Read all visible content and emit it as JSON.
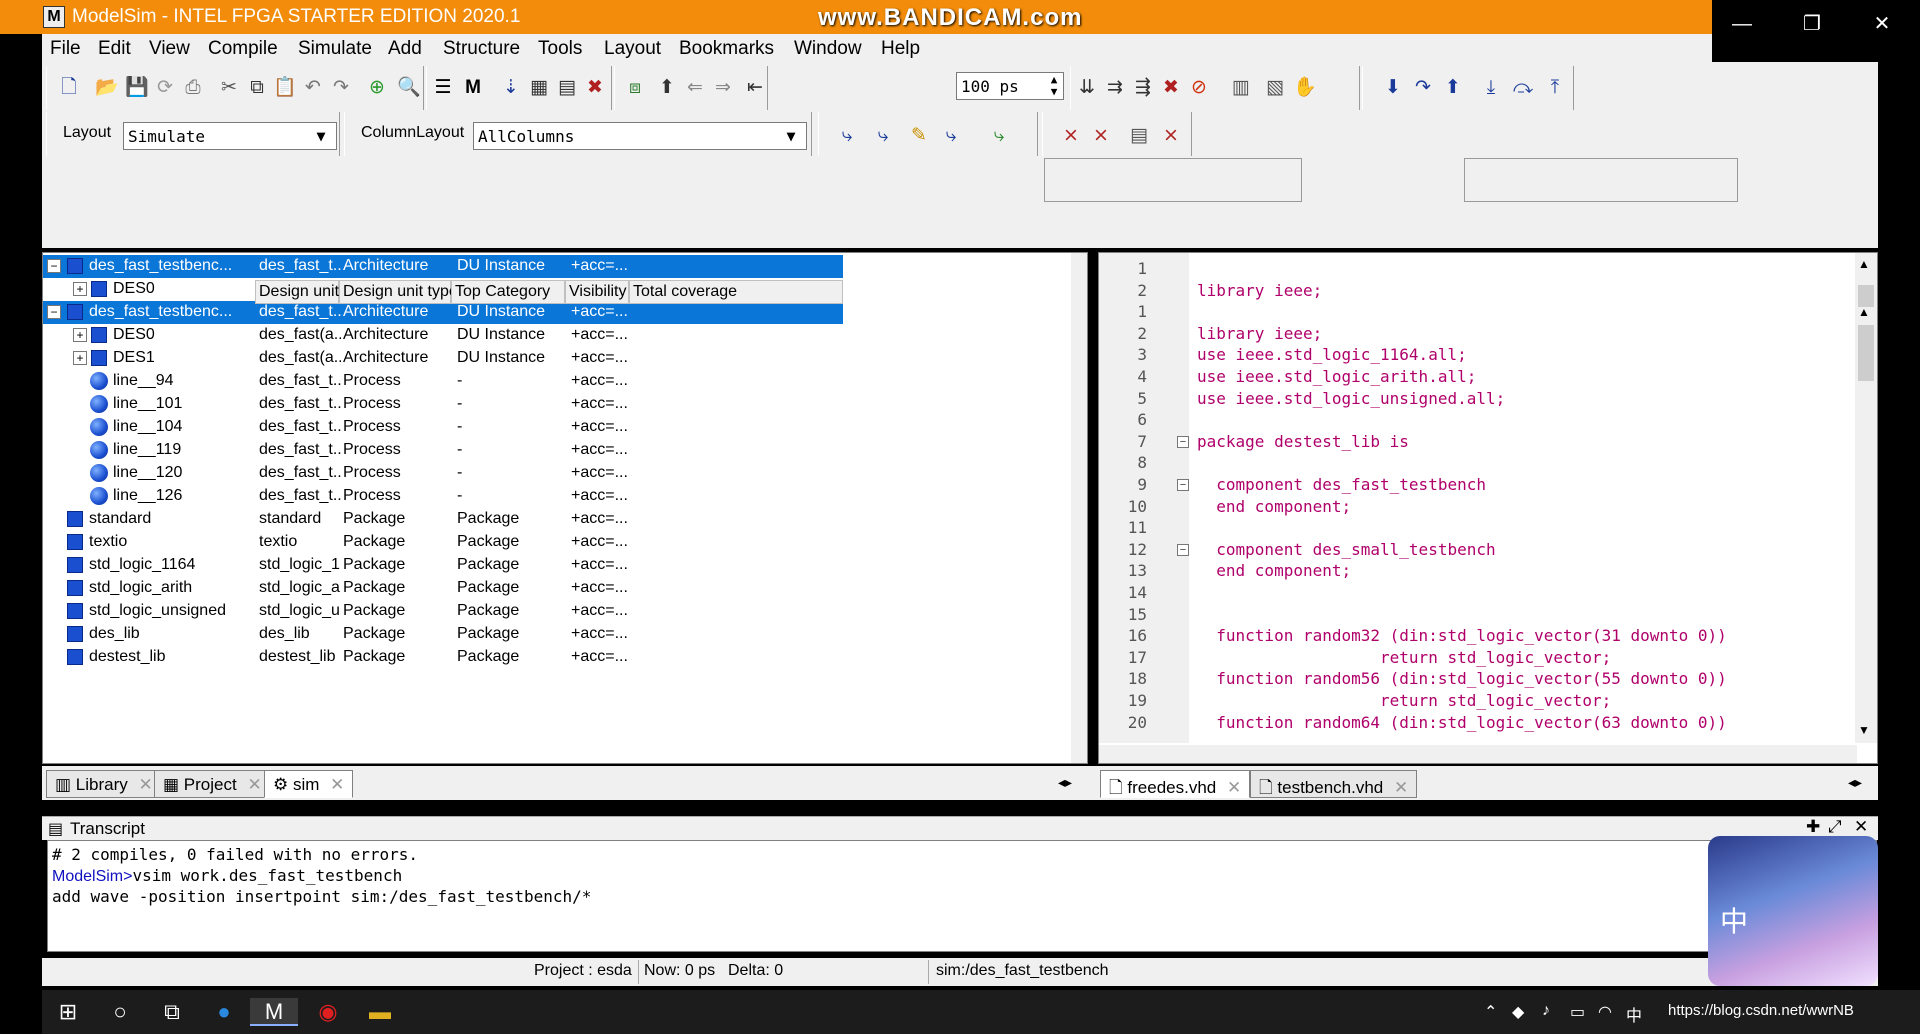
{
  "window": {
    "title": "ModelSim - INTEL FPGA STARTER EDITION 2020.1",
    "watermark": "www.BANDICAM.com",
    "app_icon": "M"
  },
  "menu": [
    "File",
    "Edit",
    "View",
    "Compile",
    "Simulate",
    "Add",
    "Structure",
    "Tools",
    "Layout",
    "Bookmarks",
    "Window",
    "Help"
  ],
  "toolbar": {
    "time_value": "100 ps",
    "layout_label": "Layout",
    "layout_value": "Simulate",
    "column_layout_label": "ColumnLayout",
    "column_layout_value": "AllColumns"
  },
  "sim": {
    "headers": [
      "Design unit",
      "Design unit type",
      "Top Category",
      "Visibility",
      "Total coverage"
    ],
    "rows": [
      {
        "name": "des_fast_testbenc...",
        "du": "des_fast_t...",
        "type": "Architecture",
        "cat": "DU Instance",
        "vis": "+acc=...",
        "selected": true
      },
      {
        "name": "DES0",
        "du": "",
        "type": "",
        "cat": "",
        "vis": "",
        "selected": false
      },
      {
        "name": "des_fast_testbenc...",
        "du": "des_fast_t...",
        "type": "Architecture",
        "cat": "DU Instance",
        "vis": "+acc=...",
        "selected": true
      },
      {
        "name": "DES0",
        "du": "des_fast(a...",
        "type": "Architecture",
        "cat": "DU Instance",
        "vis": "+acc=..."
      },
      {
        "name": "DES1",
        "du": "des_fast(a...",
        "type": "Architecture",
        "cat": "DU Instance",
        "vis": "+acc=..."
      },
      {
        "name": "line__94",
        "du": "des_fast_t...",
        "type": "Process",
        "cat": "-",
        "vis": "+acc=..."
      },
      {
        "name": "line__101",
        "du": "des_fast_t...",
        "type": "Process",
        "cat": "-",
        "vis": "+acc=..."
      },
      {
        "name": "line__104",
        "du": "des_fast_t...",
        "type": "Process",
        "cat": "-",
        "vis": "+acc=..."
      },
      {
        "name": "line__119",
        "du": "des_fast_t...",
        "type": "Process",
        "cat": "-",
        "vis": "+acc=..."
      },
      {
        "name": "line__120",
        "du": "des_fast_t...",
        "type": "Process",
        "cat": "-",
        "vis": "+acc=..."
      },
      {
        "name": "line__126",
        "du": "des_fast_t...",
        "type": "Process",
        "cat": "-",
        "vis": "+acc=..."
      },
      {
        "name": "standard",
        "du": "standard",
        "type": "Package",
        "cat": "Package",
        "vis": "+acc=..."
      },
      {
        "name": "textio",
        "du": "textio",
        "type": "Package",
        "cat": "Package",
        "vis": "+acc=..."
      },
      {
        "name": "std_logic_1164",
        "du": "std_logic_1...",
        "type": "Package",
        "cat": "Package",
        "vis": "+acc=..."
      },
      {
        "name": "std_logic_arith",
        "du": "std_logic_a...",
        "type": "Package",
        "cat": "Package",
        "vis": "+acc=..."
      },
      {
        "name": "std_logic_unsigned",
        "du": "std_logic_u...",
        "type": "Package",
        "cat": "Package",
        "vis": "+acc=..."
      },
      {
        "name": "des_lib",
        "du": "des_lib",
        "type": "Package",
        "cat": "Package",
        "vis": "+acc=..."
      },
      {
        "name": "destest_lib",
        "du": "destest_lib",
        "type": "Package",
        "cat": "Package",
        "vis": "+acc=..."
      }
    ]
  },
  "source": {
    "lines": [
      {
        "n": "1",
        "text": ""
      },
      {
        "n": "2",
        "text": "library ieee;"
      },
      {
        "n": "1",
        "text": ""
      },
      {
        "n": "2",
        "text": "library ieee;"
      },
      {
        "n": "3",
        "text": "use ieee.std_logic_1164.all;"
      },
      {
        "n": "4",
        "text": "use ieee.std_logic_arith.all;"
      },
      {
        "n": "5",
        "text": "use ieee.std_logic_unsigned.all;"
      },
      {
        "n": "6",
        "text": ""
      },
      {
        "n": "7",
        "text": "package destest_lib is"
      },
      {
        "n": "8",
        "text": ""
      },
      {
        "n": "9",
        "text": "  component des_fast_testbench"
      },
      {
        "n": "10",
        "text": "  end component;"
      },
      {
        "n": "11",
        "text": ""
      },
      {
        "n": "12",
        "text": "  component des_small_testbench"
      },
      {
        "n": "13",
        "text": "  end component;"
      },
      {
        "n": "14",
        "text": ""
      },
      {
        "n": "15",
        "text": ""
      },
      {
        "n": "16",
        "text": "  function random32 (din:std_logic_vector(31 downto 0))"
      },
      {
        "n": "17",
        "text": "                   return std_logic_vector;"
      },
      {
        "n": "18",
        "text": "  function random56 (din:std_logic_vector(55 downto 0))"
      },
      {
        "n": "19",
        "text": "                   return std_logic_vector;"
      },
      {
        "n": "20",
        "text": "  function random64 (din:std_logic_vector(63 downto 0))"
      }
    ]
  },
  "tabs": {
    "left": [
      "Library",
      "Project",
      "sim"
    ],
    "right": [
      "freedes.vhd",
      "testbench.vhd"
    ]
  },
  "transcript": {
    "title": "Transcript",
    "lines": [
      "# 2 compiles, 0 failed with no errors.",
      "vsim work.des_fast_testbench",
      "add wave -position insertpoint sim:/des_fast_testbench/*"
    ],
    "prompt": "ModelSim>"
  },
  "status": {
    "project": "Project : esda",
    "now": "Now: 0 ps",
    "delta": "Delta: 0",
    "context": "sim:/des_fast_testbench"
  },
  "taskbar": {
    "ime": "中",
    "url": "https://blog.csdn.net/wwrNB"
  },
  "avatar": {
    "ime": "中"
  }
}
